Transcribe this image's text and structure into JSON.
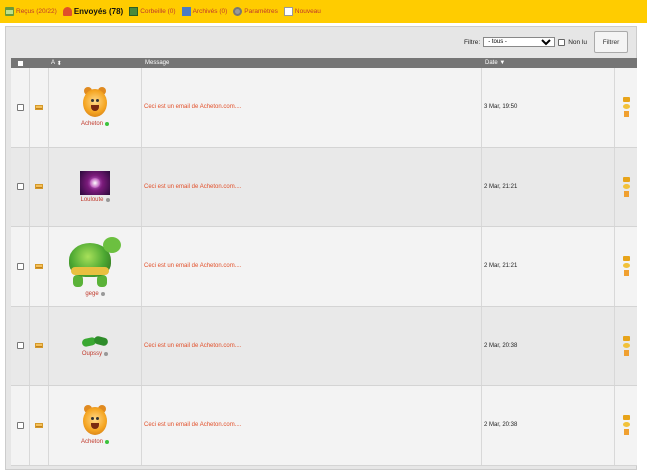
{
  "tabs": [
    {
      "label": "Reçus (20/22)",
      "icon": "inbox-icon",
      "active": false
    },
    {
      "label": "Envoyés (78)",
      "icon": "sent-icon",
      "active": true
    },
    {
      "label": "Corbeille (0)",
      "icon": "trash-icon",
      "active": false
    },
    {
      "label": "Archivés (0)",
      "icon": "archive-icon",
      "active": false
    },
    {
      "label": "Paramètres",
      "icon": "settings-icon",
      "active": false
    },
    {
      "label": "Nouveau",
      "icon": "new-message-icon",
      "active": false
    }
  ],
  "filter": {
    "label": "Filtre:",
    "selected": "- tous -",
    "unread_label": "Non lu",
    "button_label": "Filtrer"
  },
  "table": {
    "header": {
      "author": "A",
      "message": "Message",
      "date": "Date"
    },
    "rows": [
      {
        "author": "Acheton",
        "online": true,
        "avatar": "bear-avatar",
        "message": "Ceci est un email de Acheton.com....",
        "date": "3 Mar, 19:50"
      },
      {
        "author": "Louloute",
        "online": false,
        "avatar": "purple-eye-avatar",
        "message": "Ceci est un email de Acheton.com....",
        "date": "2 Mar, 21:21"
      },
      {
        "author": "gege",
        "online": false,
        "avatar": "turtle-avatar",
        "message": "Ceci est un email de Acheton.com....",
        "date": "2 Mar, 21:21"
      },
      {
        "author": "Oupssy",
        "online": false,
        "avatar": "hand-avatar",
        "message": "Ceci est un email de Acheton.com....",
        "date": "2 Mar, 20:38"
      },
      {
        "author": "Acheton",
        "online": true,
        "avatar": "bear-avatar",
        "message": "Ceci est un email de Acheton.com....",
        "date": "2 Mar, 20:38"
      }
    ]
  },
  "colors": {
    "tabbar": "#ffcc00",
    "link": "#e2502a",
    "header": "#757575",
    "online": "#3cc33c",
    "offline": "#999999"
  }
}
